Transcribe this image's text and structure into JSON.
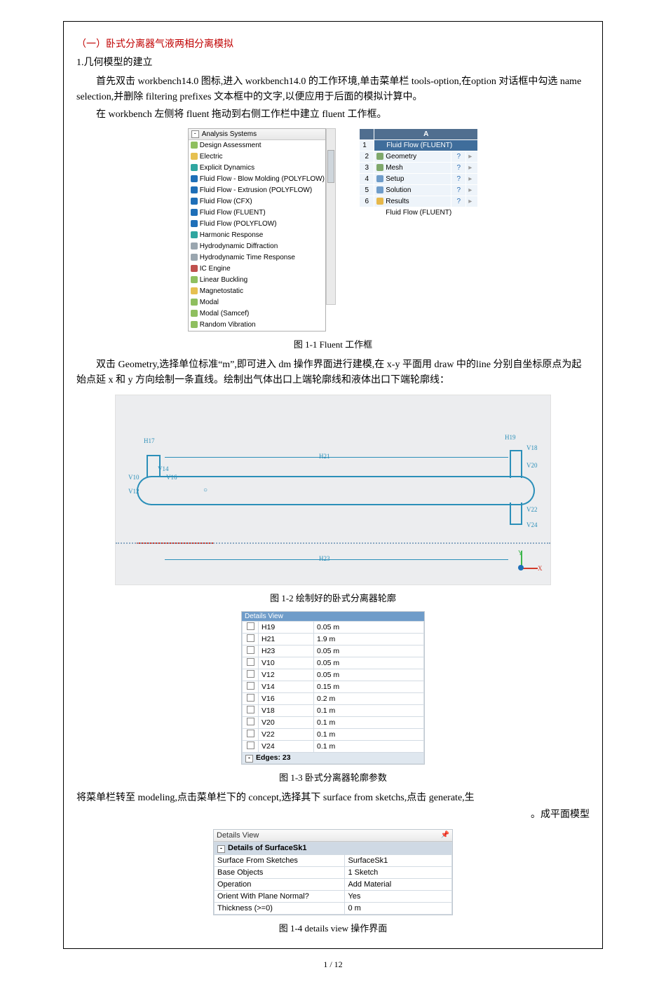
{
  "meta": {
    "page_number": "1 / 12"
  },
  "title_line": "（一）卧式分离器气液两相分离模拟",
  "subheading": "1.几何模型的建立",
  "para1": "首先双击 workbench14.0 图标,进入 workbench14.0 的工作环境,单击菜单栏 tools-option,在option 对话框中勾选 name selection,并删除 filtering prefixes 文本框中的文字,以便应用于后面的模拟计算中。",
  "para2": "在 workbench 左侧将 fluent 拖动到右侧工作栏中建立 fluent 工作框。",
  "fig1_1": {
    "header": "Analysis Systems",
    "caption": "图 1-1  Fluent 工作框",
    "items": [
      {
        "name": "Design Assessment",
        "ico": "ico-green"
      },
      {
        "name": "Electric",
        "ico": "ico-yellow"
      },
      {
        "name": "Explicit Dynamics",
        "ico": "ico-teal"
      },
      {
        "name": "Fluid Flow - Blow Molding (POLYFLOW)",
        "ico": "ico-blue"
      },
      {
        "name": "Fluid Flow - Extrusion (POLYFLOW)",
        "ico": "ico-blue"
      },
      {
        "name": "Fluid Flow (CFX)",
        "ico": "ico-blue"
      },
      {
        "name": "Fluid Flow (FLUENT)",
        "ico": "ico-blue"
      },
      {
        "name": "Fluid Flow (POLYFLOW)",
        "ico": "ico-blue"
      },
      {
        "name": "Harmonic Response",
        "ico": "ico-teal"
      },
      {
        "name": "Hydrodynamic Diffraction",
        "ico": "ico-gray"
      },
      {
        "name": "Hydrodynamic Time Response",
        "ico": "ico-gray"
      },
      {
        "name": "IC Engine",
        "ico": "ico-red"
      },
      {
        "name": "Linear Buckling",
        "ico": "ico-green"
      },
      {
        "name": "Magnetostatic",
        "ico": "ico-yellow"
      },
      {
        "name": "Modal",
        "ico": "ico-green"
      },
      {
        "name": "Modal (Samcef)",
        "ico": "ico-green"
      },
      {
        "name": "Random Vibration",
        "ico": "ico-green"
      }
    ],
    "schematic": {
      "col": "A",
      "title": "Fluid Flow (FLUENT)",
      "rows": [
        {
          "n": "2",
          "label": "Geometry",
          "q": "?"
        },
        {
          "n": "3",
          "label": "Mesh",
          "q": "?"
        },
        {
          "n": "4",
          "label": "Setup",
          "q": "?"
        },
        {
          "n": "5",
          "label": "Solution",
          "q": "?"
        },
        {
          "n": "6",
          "label": "Results",
          "q": "?"
        }
      ],
      "footer": "Fluid Flow (FLUENT)"
    }
  },
  "para3": "双击 Geometry,选择单位标准“m”,即可进入 dm 操作界面进行建模,在 x-y 平面用 draw 中的line 分别自坐标原点为起始点延 x 和 y 方向绘制一条直线。绘制出气体出口上端轮廓线和液体出口下端轮廓线：",
  "fig1_2": {
    "caption": "图 1-2 绘制好的卧式分离器轮廓",
    "dims": {
      "h17": "H17",
      "h21": "H21",
      "h23": "H23",
      "v10": "V10",
      "v12": "V12",
      "v14": "V14",
      "v16": "V16",
      "v18": "V18",
      "v20": "V20",
      "v22": "V22",
      "v24": "V24"
    }
  },
  "fig1_3": {
    "header": "Details View",
    "caption": "图 1-3 卧式分离器轮廓参数",
    "rows": [
      {
        "name": "H19",
        "value": "0.05 m"
      },
      {
        "name": "H21",
        "value": "1.9 m"
      },
      {
        "name": "H23",
        "value": "0.05 m"
      },
      {
        "name": "V10",
        "value": "0.05 m"
      },
      {
        "name": "V12",
        "value": "0.05 m"
      },
      {
        "name": "V14",
        "value": "0.15 m"
      },
      {
        "name": "V16",
        "value": "0.2 m"
      },
      {
        "name": "V18",
        "value": "0.1 m"
      },
      {
        "name": "V20",
        "value": "0.1 m"
      },
      {
        "name": "V22",
        "value": "0.1 m"
      },
      {
        "name": "V24",
        "value": "0.1 m"
      }
    ],
    "group": "Edges: 23"
  },
  "para4_prefix": "将菜单栏转至 modeling,点击菜单栏下的 concept,选择其下 surface from sketchs,点击 generate,生",
  "para4_suffix": "。成平面模型",
  "fig1_4": {
    "header": "Details View",
    "group": "Details of SurfaceSk1",
    "caption": "图 1-4 details view 操作界面",
    "rows": [
      {
        "k": "Surface From Sketches",
        "v": "SurfaceSk1"
      },
      {
        "k": "Base Objects",
        "v": "1 Sketch"
      },
      {
        "k": "Operation",
        "v": "Add Material"
      },
      {
        "k": "Orient With Plane Normal?",
        "v": "Yes"
      },
      {
        "k": "Thickness (>=0)",
        "v": "0 m"
      }
    ]
  }
}
